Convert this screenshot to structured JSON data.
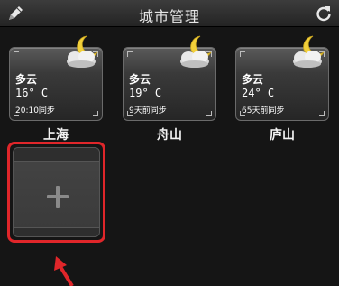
{
  "header": {
    "title": "城市管理",
    "left_icon": "pencil-icon",
    "right_icon": "refresh-icon"
  },
  "cities": [
    {
      "name": "上海",
      "condition": "多云",
      "temperature": "16° C",
      "sync": "20:10同步",
      "icon": "moon-cloud-icon"
    },
    {
      "name": "舟山",
      "condition": "多云",
      "temperature": "19° C",
      "sync": "9天前同步",
      "icon": "moon-cloud-icon"
    },
    {
      "name": "庐山",
      "condition": "多云",
      "temperature": "24° C",
      "sync": "65天前同步",
      "icon": "moon-cloud-icon"
    }
  ],
  "add_card": {
    "icon": "plus-icon"
  },
  "annotation": {
    "highlight_color": "#e0262a",
    "pointer": "arrow-icon"
  }
}
